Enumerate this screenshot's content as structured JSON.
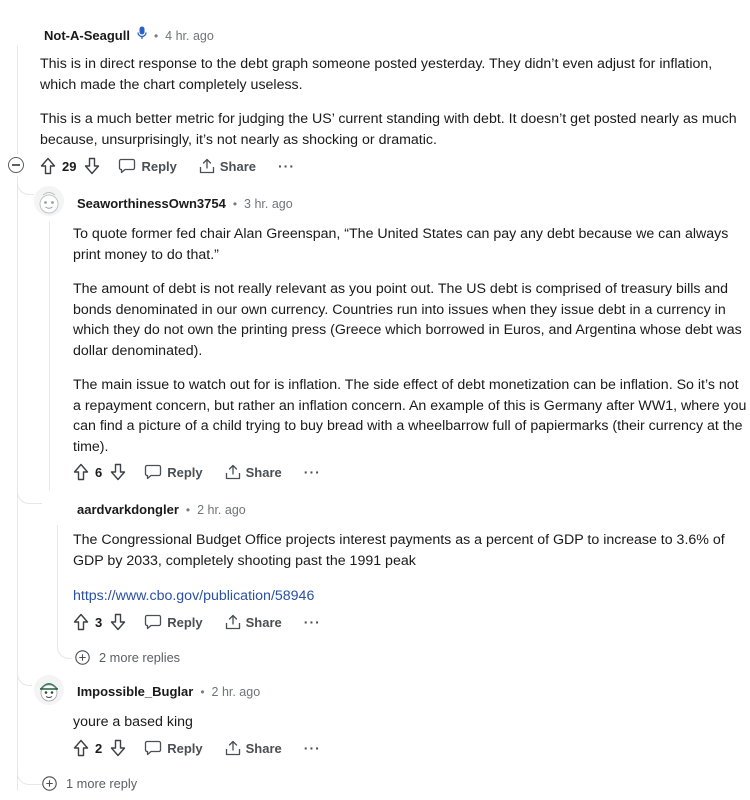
{
  "comments": [
    {
      "author": "Not-A-Seagull",
      "time": "4 hr. ago",
      "paragraphs": [
        "This is in direct response to the debt graph someone posted yesterday. They didn’t even adjust for inflation, which made the chart completely useless.",
        "This is a much better metric for judging the US’ current standing with debt. It doesn’t get posted nearly as much because, unsurprisingly, it’s not nearly as shocking or dramatic."
      ],
      "score": "29"
    },
    {
      "author": "SeaworthinessOwn3754",
      "time": "3 hr. ago",
      "paragraphs": [
        "To quote former fed chair Alan Greenspan, “The United States can pay any debt because we can always print money to do that.”",
        "The amount of debt is not really relevant as you point out. The US debt is comprised of treasury bills and bonds denominated in our own currency. Countries run into issues when they issue debt in a currency in which they do not own the printing press (Greece which borrowed in Euros, and Argentina whose debt was dollar denominated).",
        "The main issue to watch out for is inflation. The side effect of debt monetization can be inflation. So it’s not a repayment concern, but rather an inflation concern. An example of this is Germany after WW1, where you can find a picture of a child trying to buy bread with a wheelbarrow full of papiermarks (their currency at the time)."
      ],
      "score": "6"
    },
    {
      "author": "aardvarkdongler",
      "time": "2 hr. ago",
      "paragraphs": [
        "The Congressional Budget Office projects interest payments as a percent of GDP to increase to 3.6% of GDP by 2033, completely shooting past the 1991 peak"
      ],
      "link": "https://www.cbo.gov/publication/58946",
      "score": "3",
      "more_replies": "2 more replies"
    },
    {
      "author": "Impossible_Buglar",
      "time": "2 hr. ago",
      "paragraphs": [
        "youre a based king"
      ],
      "score": "2"
    }
  ],
  "actions": {
    "reply": "Reply",
    "share": "Share",
    "more": "···"
  },
  "bottom_more": "1 more reply",
  "colors": {
    "link": "#2a50a3",
    "line": "#e5e7e9",
    "mic": "#2a60c9"
  }
}
